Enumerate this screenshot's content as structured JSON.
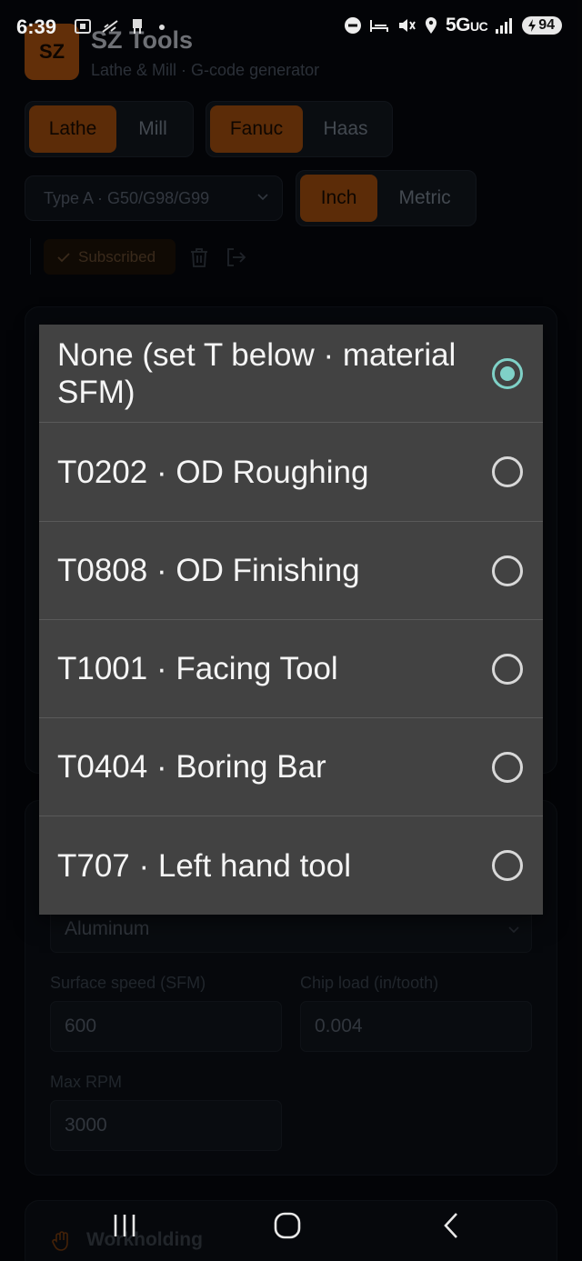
{
  "status_bar": {
    "time": "6:39",
    "network": "5G",
    "network_suffix": "UC",
    "battery": "94"
  },
  "app": {
    "logo_text": "SZ",
    "title": "SZ Tools",
    "subtitle": "Lathe & Mill · G-code generator"
  },
  "machine_toggle": {
    "options": [
      "Lathe",
      "Mill"
    ],
    "selected": "Lathe"
  },
  "control_toggle": {
    "options": [
      "Fanuc",
      "Haas"
    ],
    "selected": "Fanuc"
  },
  "type_select": {
    "value": "Type A · G50/G98/G99"
  },
  "units_toggle": {
    "options": [
      "Inch",
      "Metric"
    ],
    "selected": "Inch"
  },
  "subscription": {
    "label": "Subscribed"
  },
  "material": {
    "value": "Aluminum"
  },
  "fields": {
    "surface_speed": {
      "label": "Surface speed (SFM)",
      "value": "600"
    },
    "chip_load": {
      "label": "Chip load (in/tooth)",
      "value": "0.004"
    },
    "max_rpm": {
      "label": "Max RPM",
      "value": "3000"
    }
  },
  "workholding": {
    "label": "Workholding"
  },
  "tool_dialog": {
    "selected_index": 0,
    "options": [
      {
        "label": "None (set T below · material SFM)"
      },
      {
        "label": "T0202 · OD Roughing"
      },
      {
        "label": "T0808 · OD Finishing"
      },
      {
        "label": "T1001 · Facing Tool"
      },
      {
        "label": "T0404 · Boring Bar"
      },
      {
        "label": "T707 · Left hand tool"
      }
    ]
  }
}
